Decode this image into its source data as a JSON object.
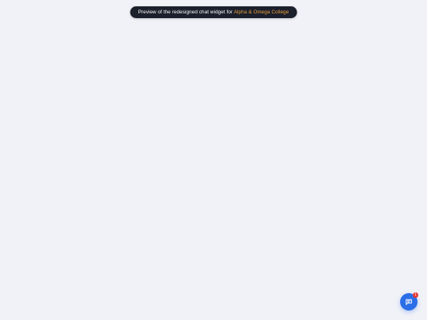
{
  "banner": {
    "text": "Preview of the redesigned chat widget for ",
    "college_name": "Alpha & Omega College"
  },
  "chat_launcher": {
    "icon": "chat-bubble-icon",
    "unread_count": "1"
  },
  "colors": {
    "page_background": "#f1f2f7",
    "banner_background": "#1c1f2c",
    "college_highlight": "#e8a23c",
    "launcher_accent": "#2a6ee8",
    "badge": "#e53935"
  }
}
